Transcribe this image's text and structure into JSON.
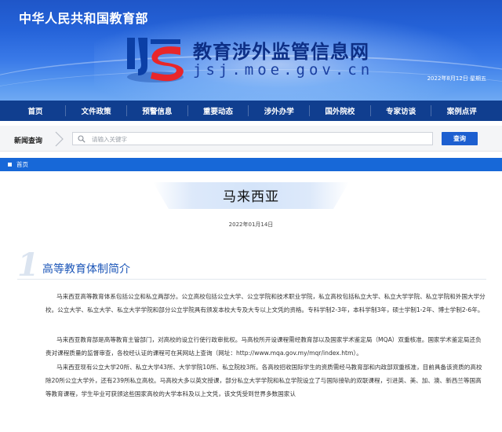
{
  "header": {
    "ministry": "中华人民共和国教育部",
    "site_title": "教育涉外监管信息网",
    "site_domain": "jsj.moe.gov.cn",
    "date": "2022年8月12日  星期五",
    "logo_icon": "jsj-logo-icon"
  },
  "nav": {
    "items": [
      {
        "label": "首页"
      },
      {
        "label": "文件政策"
      },
      {
        "label": "预警信息"
      },
      {
        "label": "重要动态"
      },
      {
        "label": "涉外办学"
      },
      {
        "label": "国外院校"
      },
      {
        "label": "专家访谈"
      },
      {
        "label": "案例点评"
      }
    ]
  },
  "search": {
    "label": "新闻查询",
    "placeholder": "请输入关键字",
    "value": "",
    "button": "查询",
    "icon": "search-icon"
  },
  "breadcrumb": {
    "home": "首页"
  },
  "article": {
    "title": "马来西亚",
    "date": "2022年01月14日",
    "section": {
      "number": "1",
      "title": "高等教育体制简介"
    },
    "paragraphs": [
      "马来西亚高等教育体系包括公立和私立两部分。公立高校包括公立大学、公立学院和技术职业学院，私立高校包括私立大学、私立大学学院、私立学院和外国大学分校。公立大学、私立大学、私立大学学院和部分公立学院具有颁发本校大专及大专以上文凭的资格。专科学制2-3年，本科学制3年，硕士学制1-2年、博士学制2-6年。",
      "马来西亚教育部是高等教育主管部门，对高校的设立行使行政审批权。马高校所开设课程需经教育部以及国家学术鉴定局（MQA）双重核准。国家学术鉴定局还负责对课程质量的监督审查，各校经认证的课程可在其网站上查询（网址：http://www.mqa.gov.my/mqr/index.htm）。",
      "马来西亚现有公立大学20所、私立大学43所、大学学院10所、私立院校3所。各高校招收国际学生的资质需经马教育部和内政部双重核准，目前具备该资质的高校除20所公立大学外，还有239所私立高校。马高校大多以英文授课，部分私立大学学院和私立学院设立了与国际接轨的双联课程，引进英、美、加、澳、新西兰等国高等教育课程，学生毕业可获颁这些国家高校的大学本科及以上文凭，该文凭受到世界多数国家认"
    ]
  },
  "colors": {
    "banner_top": "#1f56c8",
    "nav_bg": "#103e8f",
    "breadcrumb_bg": "#1768d8",
    "search_button": "#1d5fd0",
    "section_title": "#1c56b8",
    "logo_red": "#e8262a"
  }
}
